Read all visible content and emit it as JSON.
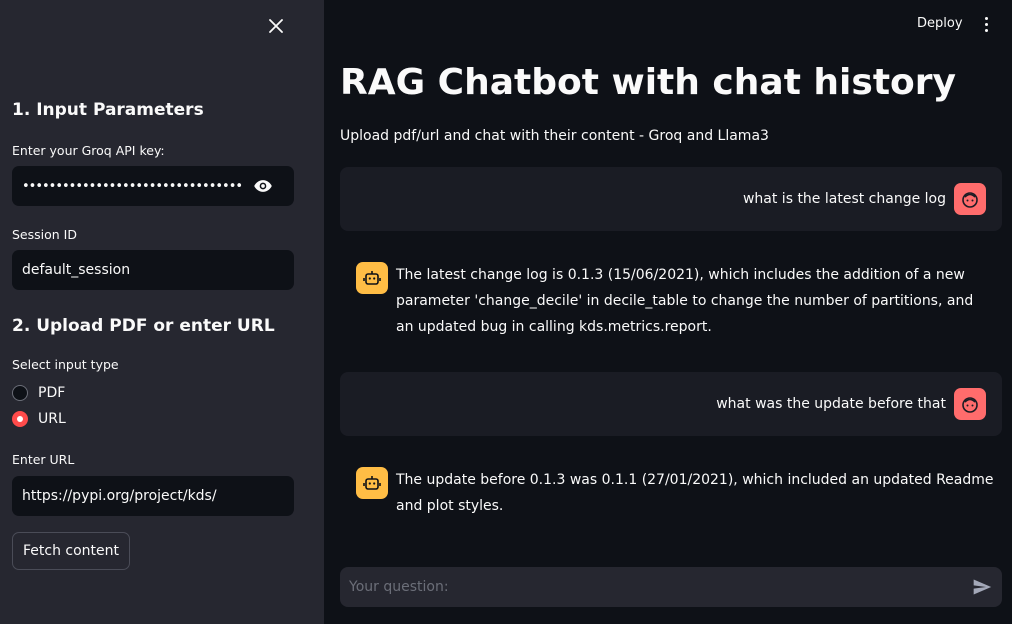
{
  "sidebar": {
    "section1_title": "1. Input Parameters",
    "api_key_label": "Enter your Groq API key:",
    "api_key_value": "••••••••••••••••••••••••••••••••••••••••••••••••••••",
    "session_label": "Session ID",
    "session_value": "default_session",
    "section2_title": "2. Upload PDF or enter URL",
    "input_type_label": "Select input type",
    "radio_options": [
      {
        "label": "PDF",
        "selected": false
      },
      {
        "label": "URL",
        "selected": true
      }
    ],
    "url_label": "Enter URL",
    "url_value": "https://pypi.org/project/kds/",
    "fetch_button": "Fetch content"
  },
  "header": {
    "deploy_label": "Deploy"
  },
  "main": {
    "title": "RAG Chatbot with chat history",
    "subtitle": "Upload pdf/url and chat with their content - Groq and Llama3",
    "messages": [
      {
        "role": "user",
        "text": "what is the latest change log"
      },
      {
        "role": "assistant",
        "text": "The latest change log is 0.1.3 (15/06/2021), which includes the addition of a new parameter 'change_decile' in decile_table to change the number of partitions, and an updated bug in calling kds.metrics.report."
      },
      {
        "role": "user",
        "text": "what was the update before that"
      },
      {
        "role": "assistant",
        "text": "The update before 0.1.3 was 0.1.1 (27/01/2021), which included an updated Readme and plot styles."
      }
    ],
    "chat_placeholder": "Your question:"
  },
  "colors": {
    "background": "#0e1117",
    "sidebar": "#262730",
    "accent": "#ff4b4b",
    "user_avatar": "#ff6c6c",
    "bot_avatar": "#ffbd45"
  }
}
